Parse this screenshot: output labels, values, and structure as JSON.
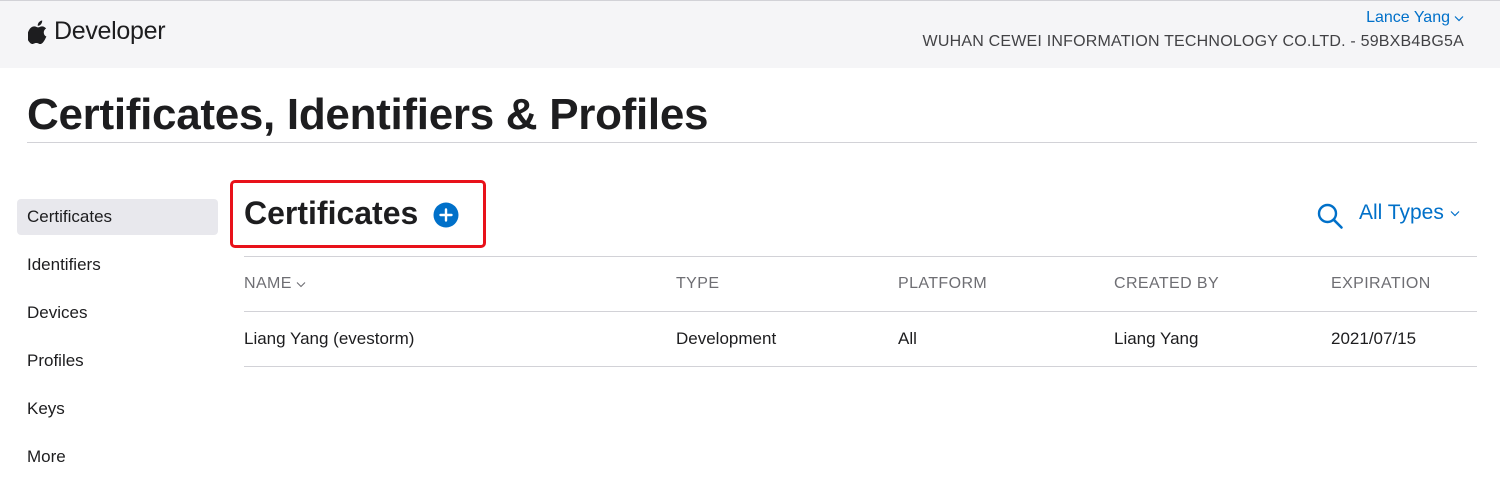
{
  "header": {
    "brand": "Developer",
    "user_name": "Lance Yang",
    "team": "WUHAN CEWEI INFORMATION TECHNOLOGY CO.LTD. - 59BXB4BG5A"
  },
  "page_title": "Certificates, Identifiers & Profiles",
  "sidebar": {
    "items": [
      {
        "label": "Certificates",
        "active": true
      },
      {
        "label": "Identifiers"
      },
      {
        "label": "Devices"
      },
      {
        "label": "Profiles"
      },
      {
        "label": "Keys"
      },
      {
        "label": "More"
      }
    ]
  },
  "section": {
    "title": "Certificates",
    "filter_label": "All Types"
  },
  "table": {
    "columns": [
      "NAME",
      "TYPE",
      "PLATFORM",
      "CREATED BY",
      "EXPIRATION"
    ],
    "rows": [
      [
        "Liang Yang (evestorm)",
        "Development",
        "All",
        "Liang Yang",
        "2021/07/15"
      ]
    ]
  },
  "colors": {
    "accent": "#0070c9",
    "highlight_box": "#e8111a",
    "header_bg": "#f5f5f7"
  },
  "icons": {
    "logo": "apple-logo-icon",
    "add": "plus-circle-icon",
    "search": "search-icon",
    "dropdown": "chevron-down-icon"
  }
}
